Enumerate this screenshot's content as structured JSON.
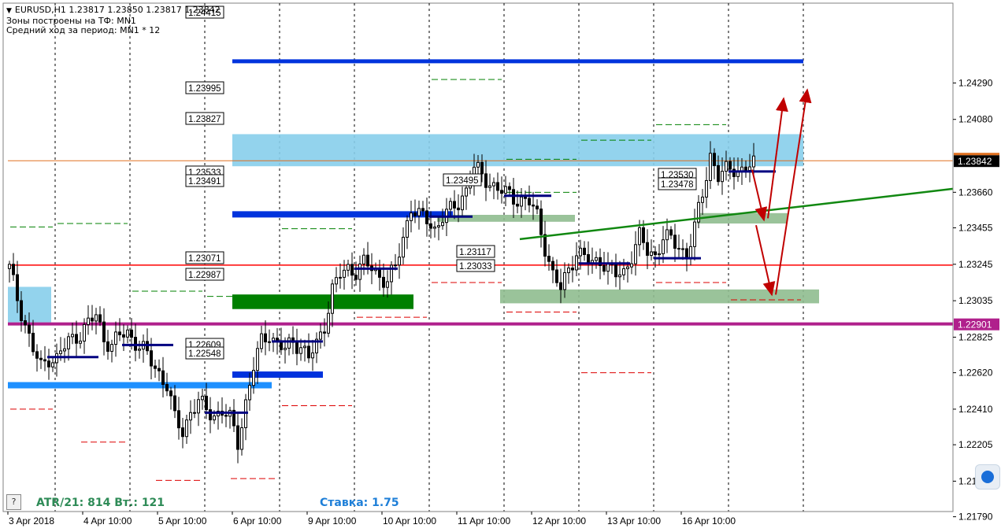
{
  "header": {
    "symbol_line": "EURUSD,H1  1.23817 1.23850 1.23817 1.23842",
    "line2": "Зоны построены на ТФ: MN1",
    "line3": "Средний ход за период: MN1 * 12"
  },
  "footer": {
    "help": "?",
    "atr_text": "ATR/21: 814  Вт.: 121",
    "stake_text": "Ставка: 1.75"
  },
  "colors": {
    "zone_light_blue": "#87ceeb",
    "zone_green": "#8fbc8f",
    "zone_dark_green": "#008000",
    "level_blue": "#0033dd",
    "level_red": "#ff0000",
    "level_magenta": "#b0208c",
    "level_orange": "#e07020",
    "trendline_green": "#118811",
    "arrow_red": "#c00000",
    "candle": "#000000",
    "price_tag_red": "#e00000",
    "price_tag_magenta": "#b0208c",
    "pivot_navy": "#000080"
  },
  "chart_data": {
    "type": "candlestick",
    "symbol": "EURUSD",
    "timeframe": "H1",
    "ohlc_last": {
      "open": 1.23817,
      "high": 1.2385,
      "low": 1.23817,
      "close": 1.23842
    },
    "current_price": "1.23842",
    "y_range": [
      1.2182,
      1.2475
    ],
    "y_ticks": [
      "1.24290",
      "1.24080",
      "1.23660",
      "1.23455",
      "1.23245",
      "1.23035",
      "1.22825",
      "1.22620",
      "1.22410",
      "1.22205",
      "1.21995",
      "1.21790"
    ],
    "y_tick_values": [
      1.2429,
      1.2408,
      1.2366,
      1.23455,
      1.23245,
      1.23035,
      1.22825,
      1.2262,
      1.2241,
      1.22205,
      1.21995,
      1.2179
    ],
    "x_labels": [
      "3 Apr 2018",
      "4 Apr 10:00",
      "5 Apr 10:00",
      "6 Apr 10:00",
      "9 Apr 10:00",
      "10 Apr 10:00",
      "11 Apr 10:00",
      "12 Apr 10:00",
      "13 Apr 10:00",
      "16 Apr 10:00"
    ],
    "x_label_bar": [
      0,
      19,
      38,
      57,
      76,
      95,
      114,
      133,
      152,
      171
    ],
    "session_separators": [
      12,
      31,
      50,
      69,
      88,
      107,
      126,
      145,
      164,
      183,
      202
    ],
    "bar_count": 190,
    "bar_spacing_note": "",
    "zones": [
      {
        "color": "light_blue",
        "from": 1.23995,
        "to": 1.2381,
        "x0": 57,
        "x1": 202
      },
      {
        "color": "light_blue",
        "from": 1.23115,
        "to": 1.2291,
        "x0": 0,
        "x1": 11
      },
      {
        "color": "green",
        "from": 1.2353,
        "to": 1.2349,
        "x0": 109,
        "x1": 144
      },
      {
        "color": "green",
        "from": 1.2354,
        "to": 1.2348,
        "x0": 175,
        "x1": 198
      },
      {
        "color": "green",
        "from": 1.231,
        "to": 1.2302,
        "x0": 125,
        "x1": 206
      },
      {
        "color": "dark_green",
        "from": 1.23071,
        "to": 1.22987,
        "x0": 57,
        "x1": 103
      }
    ],
    "level_lines": [
      {
        "value": 1.24415,
        "color": "level_blue",
        "x0": 57,
        "x1": 202,
        "width": 5
      },
      {
        "value": 1.23533,
        "color": "level_blue",
        "x0": 57,
        "x1": 113,
        "width": 8
      },
      {
        "value": 1.22609,
        "color": "level_blue",
        "x0": 57,
        "x1": 80,
        "width": 8
      },
      {
        "value": 1.22548,
        "color": "level_blue",
        "x0": 0,
        "x1": 67,
        "width": 8
      },
      {
        "value": 1.2324,
        "color": "level_red",
        "x0": 0,
        "x1": 240,
        "width": 1.5
      },
      {
        "value": 1.22901,
        "color": "level_magenta",
        "x0": 0,
        "x1": 240,
        "width": 4
      },
      {
        "value": 1.23842,
        "color": "level_orange",
        "x0": 0,
        "x1": 240,
        "width": 1
      }
    ],
    "labels": [
      {
        "text": "1.24415",
        "value": 1.24415
      },
      {
        "text": "1.23995",
        "value": 1.23995
      },
      {
        "text": "1.23827",
        "value": 1.23827
      },
      {
        "text": "1.23533",
        "value": 1.23533
      },
      {
        "text": "1.23491",
        "value": 1.23491
      },
      {
        "text": "1.23071",
        "value": 1.23071
      },
      {
        "text": "1.22987",
        "value": 1.22987
      },
      {
        "text": "1.22609",
        "value": 1.22609
      },
      {
        "text": "1.22548",
        "value": 1.22548
      },
      {
        "text": "1.23495",
        "value": 1.23495
      },
      {
        "text": "1.23117",
        "value": 1.23117
      },
      {
        "text": "1.23033",
        "value": 1.23033
      },
      {
        "text": "1.23530",
        "value": 1.2353
      },
      {
        "text": "1.23478",
        "value": 1.23478
      }
    ],
    "right_tags": [
      {
        "text": "1.23842",
        "value": 1.23842,
        "color": "#000000"
      },
      {
        "text": "1.22901",
        "value": 1.22901,
        "color": "#b0208c"
      }
    ],
    "trendline": {
      "from": {
        "bar": 130,
        "value": 1.2339
      },
      "to": {
        "bar": 240,
        "value": 1.2368
      }
    },
    "arrows": [
      {
        "from": {
          "bar": 189,
          "value": 1.2379
        },
        "to": {
          "bar": 192,
          "value": 1.235
        }
      },
      {
        "from": {
          "bar": 190,
          "value": 1.2347
        },
        "to": {
          "bar": 194,
          "value": 1.2307
        }
      },
      {
        "from": {
          "bar": 193,
          "value": 1.2351
        },
        "to": {
          "bar": 197,
          "value": 1.242
        }
      },
      {
        "from": {
          "bar": 195,
          "value": 1.2307
        },
        "to": {
          "bar": 203,
          "value": 1.2425
        }
      }
    ],
    "dashed_levels_red": [
      {
        "value": 1.2241,
        "x0": 0,
        "x1": 12
      },
      {
        "value": 1.2222,
        "x0": 18,
        "x1": 31
      },
      {
        "value": 1.22,
        "x0": 37,
        "x1": 50
      },
      {
        "value": 1.2201,
        "x0": 56,
        "x1": 69
      },
      {
        "value": 1.2243,
        "x0": 69,
        "x1": 88
      },
      {
        "value": 1.2294,
        "x0": 88,
        "x1": 107
      },
      {
        "value": 1.2314,
        "x0": 107,
        "x1": 126
      },
      {
        "value": 1.2297,
        "x0": 126,
        "x1": 145
      },
      {
        "value": 1.2262,
        "x0": 145,
        "x1": 164
      },
      {
        "value": 1.2314,
        "x0": 164,
        "x1": 183
      },
      {
        "value": 1.2304,
        "x0": 183,
        "x1": 202
      }
    ],
    "dashed_levels_green": [
      {
        "value": 1.2346,
        "x0": 0,
        "x1": 12
      },
      {
        "value": 1.2348,
        "x0": 12,
        "x1": 31
      },
      {
        "value": 1.2309,
        "x0": 31,
        "x1": 50
      },
      {
        "value": 1.2306,
        "x0": 50,
        "x1": 69
      },
      {
        "value": 1.2345,
        "x0": 69,
        "x1": 88
      },
      {
        "value": 1.2352,
        "x0": 88,
        "x1": 107
      },
      {
        "value": 1.2431,
        "x0": 107,
        "x1": 126
      },
      {
        "value": 1.2385,
        "x0": 126,
        "x1": 145
      },
      {
        "value": 1.2366,
        "x0": 126,
        "x1": 145
      },
      {
        "value": 1.2396,
        "x0": 145,
        "x1": 164
      },
      {
        "value": 1.2405,
        "x0": 164,
        "x1": 183
      }
    ],
    "pivot_lines": [
      {
        "value": 1.2271,
        "x0": 10,
        "x1": 23
      },
      {
        "value": 1.2278,
        "x0": 29,
        "x1": 42
      },
      {
        "value": 1.2239,
        "x0": 50,
        "x1": 61
      },
      {
        "value": 1.228,
        "x0": 67,
        "x1": 80
      },
      {
        "value": 1.2322,
        "x0": 88,
        "x1": 99
      },
      {
        "value": 1.2352,
        "x0": 107,
        "x1": 118
      },
      {
        "value": 1.2364,
        "x0": 126,
        "x1": 138
      },
      {
        "value": 1.2325,
        "x0": 145,
        "x1": 158
      },
      {
        "value": 1.2328,
        "x0": 164,
        "x1": 176
      },
      {
        "value": 1.2378,
        "x0": 183,
        "x1": 195
      }
    ],
    "close_path": [
      [
        0,
        1.2322
      ],
      [
        2,
        1.2305
      ],
      [
        4,
        1.229
      ],
      [
        6,
        1.2275
      ],
      [
        8,
        1.2265
      ],
      [
        10,
        1.2271
      ],
      [
        12,
        1.227
      ],
      [
        15,
        1.228
      ],
      [
        18,
        1.2285
      ],
      [
        20,
        1.229
      ],
      [
        22,
        1.2295
      ],
      [
        24,
        1.2282
      ],
      [
        26,
        1.2278
      ],
      [
        28,
        1.2283
      ],
      [
        30,
        1.2285
      ],
      [
        32,
        1.228
      ],
      [
        34,
        1.2275
      ],
      [
        36,
        1.2268
      ],
      [
        38,
        1.2262
      ],
      [
        40,
        1.2255
      ],
      [
        42,
        1.2235
      ],
      [
        44,
        1.2228
      ],
      [
        46,
        1.224
      ],
      [
        48,
        1.2245
      ],
      [
        50,
        1.224
      ],
      [
        52,
        1.2238
      ],
      [
        54,
        1.224
      ],
      [
        56,
        1.2235
      ],
      [
        58,
        1.2222
      ],
      [
        60,
        1.2245
      ],
      [
        62,
        1.2265
      ],
      [
        64,
        1.228
      ],
      [
        66,
        1.2285
      ],
      [
        68,
        1.2278
      ],
      [
        70,
        1.2275
      ],
      [
        72,
        1.228
      ],
      [
        74,
        1.2278
      ],
      [
        76,
        1.227
      ],
      [
        78,
        1.2278
      ],
      [
        80,
        1.229
      ],
      [
        82,
        1.231
      ],
      [
        84,
        1.2318
      ],
      [
        86,
        1.2322
      ],
      [
        88,
        1.2321
      ],
      [
        90,
        1.2325
      ],
      [
        92,
        1.2322
      ],
      [
        94,
        1.2318
      ],
      [
        96,
        1.2315
      ],
      [
        98,
        1.2322
      ],
      [
        100,
        1.234
      ],
      [
        102,
        1.2358
      ],
      [
        104,
        1.2352
      ],
      [
        106,
        1.235
      ],
      [
        108,
        1.2345
      ],
      [
        110,
        1.2352
      ],
      [
        112,
        1.2355
      ],
      [
        114,
        1.236
      ],
      [
        116,
        1.2368
      ],
      [
        118,
        1.238
      ],
      [
        120,
        1.2375
      ],
      [
        122,
        1.2372
      ],
      [
        124,
        1.2368
      ],
      [
        126,
        1.2365
      ],
      [
        128,
        1.2363
      ],
      [
        130,
        1.2362
      ],
      [
        132,
        1.236
      ],
      [
        134,
        1.2352
      ],
      [
        136,
        1.2335
      ],
      [
        138,
        1.2318
      ],
      [
        140,
        1.231
      ],
      [
        142,
        1.2322
      ],
      [
        144,
        1.2332
      ],
      [
        146,
        1.2328
      ],
      [
        148,
        1.2325
      ],
      [
        150,
        1.2328
      ],
      [
        152,
        1.2322
      ],
      [
        154,
        1.2318
      ],
      [
        156,
        1.232
      ],
      [
        158,
        1.233
      ],
      [
        160,
        1.234
      ],
      [
        162,
        1.2332
      ],
      [
        164,
        1.233
      ],
      [
        166,
        1.234
      ],
      [
        168,
        1.2338
      ],
      [
        170,
        1.2335
      ],
      [
        172,
        1.233
      ],
      [
        174,
        1.2345
      ],
      [
        176,
        1.2365
      ],
      [
        178,
        1.2388
      ],
      [
        180,
        1.2375
      ],
      [
        182,
        1.2378
      ],
      [
        184,
        1.238
      ],
      [
        186,
        1.2379
      ],
      [
        188,
        1.2381
      ],
      [
        190,
        1.2383
      ],
      [
        191,
        1.2384
      ]
    ]
  }
}
